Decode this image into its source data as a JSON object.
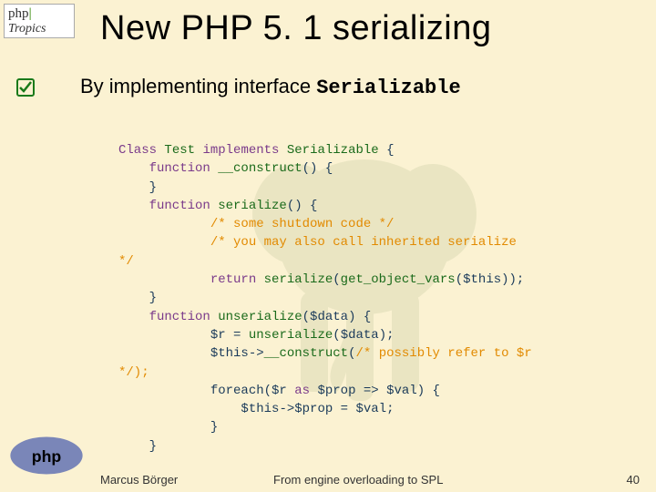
{
  "logo": {
    "line1a": "php",
    "line1b": "|",
    "line2": "Tropics"
  },
  "title": "New PHP 5. 1 serializing",
  "bullet": {
    "prefix": "By implementing interface ",
    "iface": "Serializable"
  },
  "code": {
    "l1": {
      "a": "Class ",
      "b": "Test ",
      "c": "implements ",
      "d": "Serializable ",
      "e": "{"
    },
    "l2": {
      "a": "    function ",
      "b": "__construct",
      "c": "() {"
    },
    "l3": "    }",
    "l4": {
      "a": "    function ",
      "b": "serialize",
      "c": "() {"
    },
    "l5": "            /* some shutdown code */",
    "l6": "            /* you may also call inherited serialize",
    "l7": "*/",
    "l8": {
      "a": "            ",
      "b": "return ",
      "c": "serialize",
      "d": "(",
      "e": "get_object_vars",
      "f": "(",
      "g": "$this",
      "h": "));"
    },
    "l9": "    }",
    "l10": {
      "a": "    function ",
      "b": "unserialize",
      "c": "(",
      "d": "$data",
      "e": ") {"
    },
    "l11": {
      "a": "            ",
      "b": "$r ",
      "c": "= ",
      "d": "unserialize",
      "e": "(",
      "f": "$data",
      "g": ");"
    },
    "l12": {
      "a": "            ",
      "b": "$this",
      "c": "->",
      "d": "__construct",
      "e": "(",
      "f": "/* possibly refer to $r"
    },
    "l13": "*/);",
    "l14": {
      "a": "            foreach(",
      "b": "$r ",
      "c": "as ",
      "d": "$prop ",
      "e": "=> ",
      "f": "$val",
      "g": ") {"
    },
    "l15": {
      "a": "                ",
      "b": "$this",
      "c": "->",
      "d": "$prop ",
      "e": "= ",
      "f": "$val",
      "g": ";"
    },
    "l16": "            }",
    "l17": "    }"
  },
  "footer": {
    "left": "Marcus Börger",
    "center": "From engine overloading to SPL",
    "right": "40"
  }
}
